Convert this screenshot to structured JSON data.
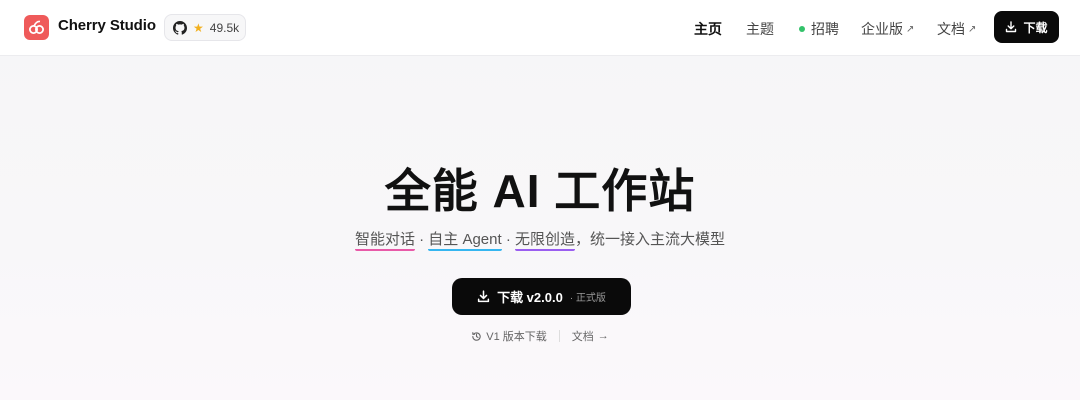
{
  "header": {
    "brand": "Cherry Studio",
    "github_stars": "49.5k",
    "nav": [
      {
        "label": "主页"
      },
      {
        "label": "主题"
      },
      {
        "label": "招聘"
      },
      {
        "label": "企业版"
      },
      {
        "label": "文档"
      }
    ],
    "download_label": "下载"
  },
  "hero": {
    "title": "全能 AI 工作站",
    "subtitle": {
      "part1": "智能对话",
      "sep1": " · ",
      "part2": "自主 Agent",
      "sep2": " · ",
      "part3": "无限创造",
      "rest": "，统一接入主流大模型"
    },
    "download": {
      "label": "下载 v2.0.0",
      "tag": "· 正式版"
    },
    "links": {
      "v1": "V1 版本下载",
      "docs": "文档"
    }
  },
  "colors": {
    "accent": "#0a0a0a",
    "logo": "#ef5a5a",
    "star": "#f2b01e",
    "recruit_dot": "#33c26a"
  }
}
